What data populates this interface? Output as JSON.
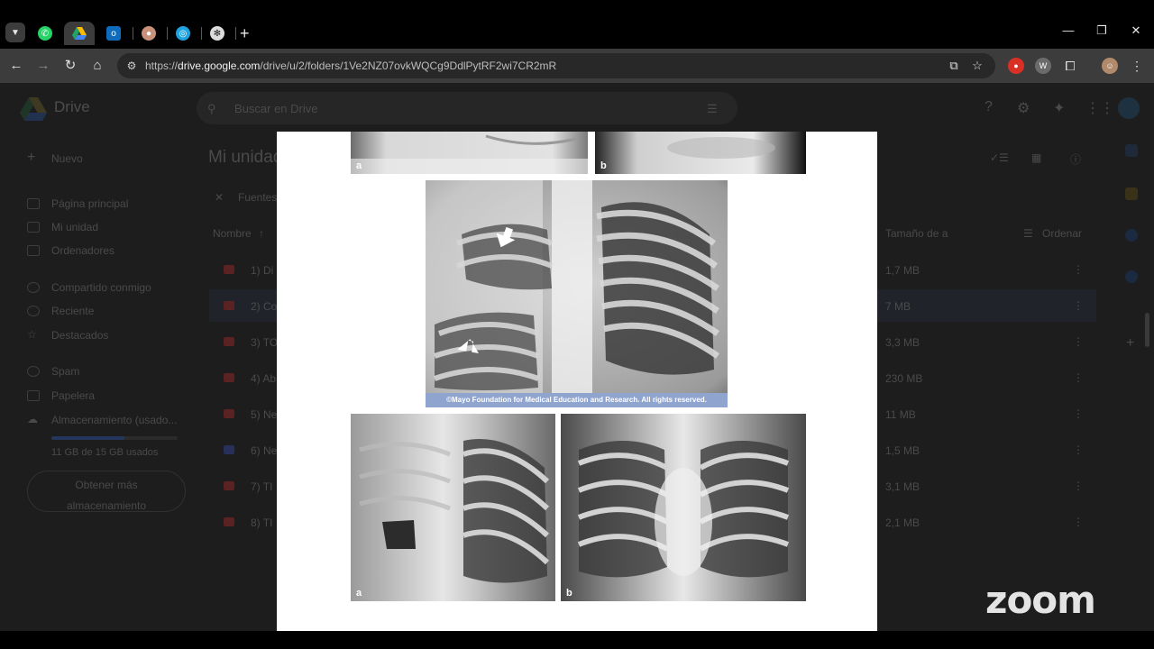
{
  "browser": {
    "tabs": [
      {
        "name": "whatsapp",
        "color": "#25d366",
        "glyph": "✆"
      },
      {
        "name": "google-drive",
        "color": "#1a73e8",
        "glyph": "▲"
      },
      {
        "name": "outlook",
        "color": "#0f6cbd",
        "glyph": "▣"
      },
      {
        "name": "brain",
        "color": "#c9917a",
        "glyph": "●"
      },
      {
        "name": "sync",
        "color": "#1fa2e0",
        "glyph": "◎"
      },
      {
        "name": "chatgpt",
        "color": "#dcdcdc",
        "glyph": "✻"
      }
    ],
    "new_tab_glyph": "+",
    "url_prefix": "https://",
    "url_host": "drive.google.com",
    "url_path": "/drive/u/2/folders/1Ve2NZ07ovkWQCg9DdlPytRF2wi7CR2mR",
    "window_controls": [
      "—",
      "❐",
      "✕"
    ]
  },
  "drive": {
    "app_name": "Drive",
    "search_placeholder": "Buscar en Drive",
    "new_button": "Nuevo",
    "page_title": "Mi unidad",
    "filter_chip": "Fuentes",
    "nav": [
      "Página principal",
      "Mi unidad",
      "Ordenadores",
      "Compartido conmigo",
      "Reciente",
      "Destacados",
      "Spam",
      "Papelera",
      "Almacenamiento (usado..."
    ],
    "storage_text": "11 GB de 15 GB usados",
    "get_storage": [
      "Obtener más",
      "almacenamiento"
    ],
    "columns": {
      "name": "Nombre",
      "size": "Tamaño de a",
      "sort": "Ordenar"
    },
    "rows": [
      {
        "name": "1) Di",
        "size": "1,7 MB"
      },
      {
        "name": "2) Co",
        "size": "7 MB"
      },
      {
        "name": "3) TO",
        "size": "3,3 MB"
      },
      {
        "name": "4) Ab",
        "size": "230 MB"
      },
      {
        "name": "5) Ne",
        "size": "11 MB"
      },
      {
        "name": "6) Ne",
        "size": "1,5 MB"
      },
      {
        "name": "7) TI",
        "size": "3,1 MB"
      },
      {
        "name": "8) TI",
        "size": "2,1 MB"
      }
    ]
  },
  "viewer": {
    "top_labels": [
      "a",
      "b"
    ],
    "caption": "©Mayo Foundation for Medical Education and Research.  All rights reserved.",
    "bottom_labels": [
      "a",
      "b"
    ]
  },
  "zoom_watermark": "zoom"
}
